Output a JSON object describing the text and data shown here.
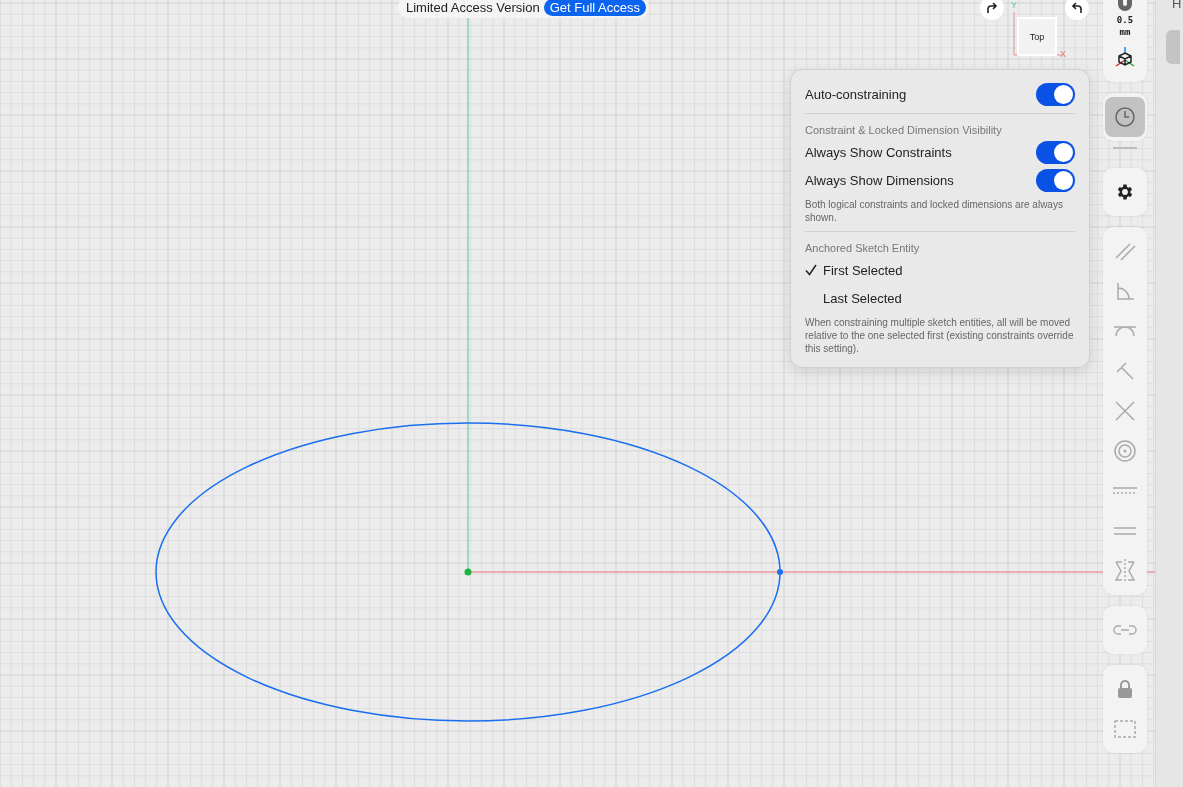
{
  "banner": {
    "label": "Limited Access Version",
    "button": "Get Full Access"
  },
  "view_cube": {
    "face": "Top",
    "y_axis": "Y",
    "x_axis": "X"
  },
  "toolbar": {
    "scale_value": "0.5",
    "scale_unit": "mm",
    "tools": [
      {
        "selected": false
      },
      {
        "selected": true
      },
      {
        "selected": false
      },
      {
        "selected": false
      },
      {
        "selected": false
      },
      {
        "selected": false
      },
      {
        "selected": false
      },
      {
        "selected": false
      },
      {
        "selected": false
      },
      {
        "selected": false
      },
      {
        "selected": false
      },
      {
        "selected": false
      },
      {
        "selected": false
      },
      {
        "selected": false
      },
      {
        "selected": false
      }
    ]
  },
  "popup": {
    "auto_constraining": {
      "label": "Auto-constraining",
      "on": true
    },
    "visibility": {
      "heading": "Constraint & Locked Dimension Visibility",
      "toggles": [
        {
          "label": "Always Show Constraints",
          "on": true
        },
        {
          "label": "Always Show Dimensions",
          "on": true
        }
      ],
      "note": "Both logical constraints and locked dimensions are always shown."
    },
    "anchor": {
      "heading": "Anchored Sketch Entity",
      "options": [
        {
          "label": "First Selected",
          "selected": true
        },
        {
          "label": "Last Selected",
          "selected": false
        }
      ],
      "note": "When constraining multiple sketch entities, all will be moved relative to the one selected first (existing constraints override this setting)."
    }
  },
  "side_panel": {
    "title": "H"
  }
}
